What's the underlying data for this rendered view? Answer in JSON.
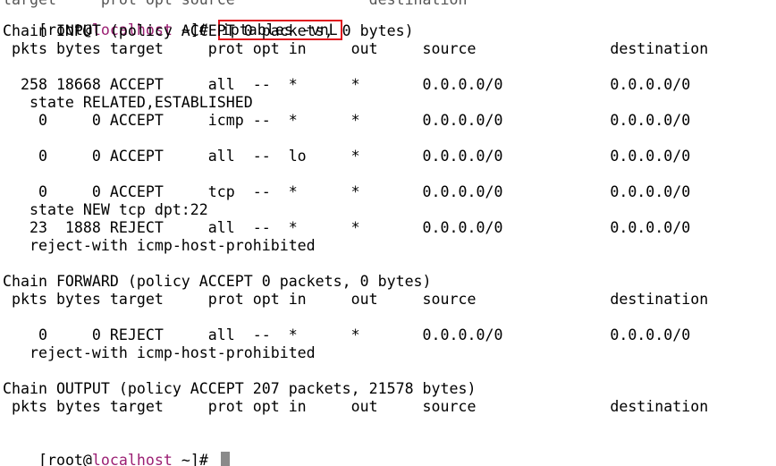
{
  "prompt": {
    "user_open": "[root@",
    "host": "localhost",
    "path_close": " ~]# "
  },
  "command": "iptables -vnL",
  "top_cut_line": "target     prot opt source               destination",
  "lines": [
    "Chain INPUT (policy ACCEPT 0 packets, 0 bytes)",
    " pkts bytes target     prot opt in     out     source               destination",
    "",
    "  258 18668 ACCEPT     all  --  *      *       0.0.0.0/0            0.0.0.0/0",
    "   state RELATED,ESTABLISHED",
    "    0     0 ACCEPT     icmp --  *      *       0.0.0.0/0            0.0.0.0/0",
    "",
    "    0     0 ACCEPT     all  --  lo     *       0.0.0.0/0            0.0.0.0/0",
    "",
    "    0     0 ACCEPT     tcp  --  *      *       0.0.0.0/0            0.0.0.0/0",
    "   state NEW tcp dpt:22",
    "   23  1888 REJECT     all  --  *      *       0.0.0.0/0            0.0.0.0/0",
    "   reject-with icmp-host-prohibited",
    "",
    "Chain FORWARD (policy ACCEPT 0 packets, 0 bytes)",
    " pkts bytes target     prot opt in     out     source               destination",
    "",
    "    0     0 REJECT     all  --  *      *       0.0.0.0/0            0.0.0.0/0",
    "   reject-with icmp-host-prohibited",
    "",
    "Chain OUTPUT (policy ACCEPT 207 packets, 21578 bytes)",
    " pkts bytes target     prot opt in     out     source               destination",
    ""
  ],
  "colors": {
    "background": "#ffffff",
    "text": "#000000",
    "hostname": "#9b1f73",
    "highlight_box": "#e0161e",
    "cursor": "#8a8a8a"
  }
}
